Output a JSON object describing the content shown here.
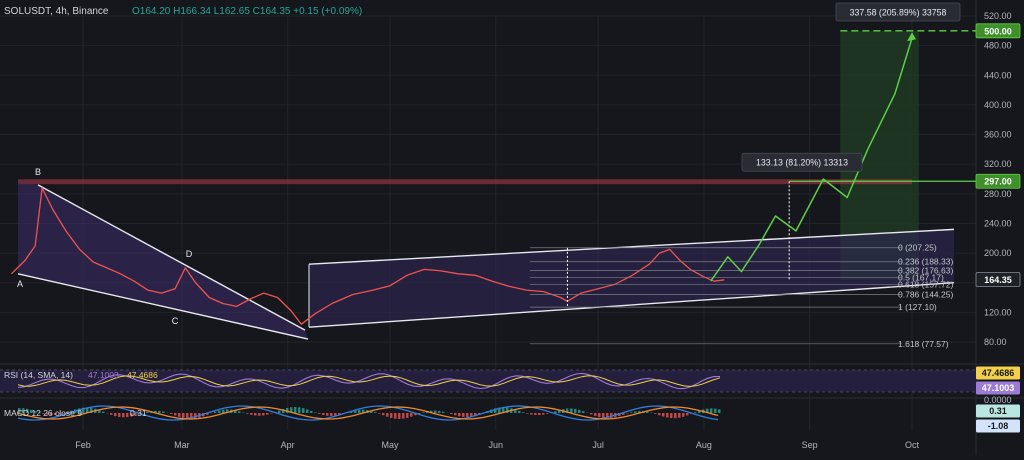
{
  "header": {
    "symbol": "SOLUSDT, 4h, Binance",
    "ohlc": "O164.20  H166.34  L162.65  C164.35  +0.15 (+0.09%)"
  },
  "colors": {
    "background": "#16171c",
    "grid": "#22242b",
    "wedge_fill": "#3d2e6b",
    "channel_fill": "#2f2654",
    "target_zone": "#1f3a24",
    "projection": "#5fcf45",
    "resistance": "#b23a48",
    "candle_up": "#26a69a",
    "candle_down": "#ef5350",
    "rsi": "#9c7bd6",
    "rsi_ma": "#f2d04a",
    "macd": "#2f7fe0",
    "signal": "#f08a2e",
    "axis_text": "#b2b5be"
  },
  "chart_data": [
    {
      "type": "line",
      "title": "SOLUSDT, 4h, Binance",
      "x_ticks": [
        "Feb",
        "Mar",
        "Apr",
        "May",
        "Jun",
        "Jul",
        "Aug",
        "Sep",
        "Oct"
      ],
      "y_ticks": [
        80,
        120,
        160,
        200,
        240,
        280,
        320,
        360,
        400,
        440,
        480,
        520
      ],
      "y_tick_labels": [
        "80.00",
        "120.00",
        "160.00",
        "200.00",
        "240.00",
        "280.00",
        "320.00",
        "360.00",
        "400.00",
        "440.00",
        "480.00",
        "520.00"
      ],
      "ylim": [
        60,
        540
      ],
      "series": [
        {
          "values": [
            [
              "Jan 11",
              172
            ],
            [
              "Jan 15",
              190
            ],
            [
              "Jan 18",
              210
            ],
            [
              "Jan 20",
              288
            ],
            [
              "Jan 23",
              260
            ],
            [
              "Jan 27",
              230
            ],
            [
              "Jan 31",
              205
            ],
            [
              "Feb 4",
              188
            ],
            [
              "Feb 8",
              180
            ],
            [
              "Feb 12",
              172
            ],
            [
              "Feb 16",
              162
            ],
            [
              "Feb 20",
              150
            ],
            [
              "Feb 24",
              146
            ],
            [
              "Feb 28",
              152
            ],
            [
              "Mar 2",
              180
            ],
            [
              "Mar 5",
              160
            ],
            [
              "Mar 9",
              140
            ],
            [
              "Mar 13",
              132
            ],
            [
              "Mar 17",
              128
            ],
            [
              "Mar 21",
              138
            ],
            [
              "Mar 25",
              146
            ],
            [
              "Mar 29",
              140
            ],
            [
              "Apr 2",
              122
            ],
            [
              "Apr 5",
              104
            ],
            [
              "Apr 9",
              118
            ],
            [
              "Apr 14",
              132
            ],
            [
              "Apr 20",
              144
            ],
            [
              "Apr 26",
              150
            ],
            [
              "May 1",
              156
            ],
            [
              "May 6",
              170
            ],
            [
              "May 11",
              178
            ],
            [
              "May 16",
              176
            ],
            [
              "May 21",
              172
            ],
            [
              "May 26",
              170
            ],
            [
              "May 31",
              162
            ],
            [
              "Jun 5",
              155
            ],
            [
              "Jun 10",
              150
            ],
            [
              "Jun 15",
              148
            ],
            [
              "Jun 20",
              140
            ],
            [
              "Jun 22",
              135
            ],
            [
              "Jun 26",
              146
            ],
            [
              "Jul 1",
              152
            ],
            [
              "Jul 6",
              158
            ],
            [
              "Jul 11",
              170
            ],
            [
              "Jul 16",
              185
            ],
            [
              "Jul 19",
              200
            ],
            [
              "Jul 22",
              205
            ],
            [
              "Jul 25",
              190
            ],
            [
              "Jul 28",
              178
            ],
            [
              "Aug 1",
              168
            ],
            [
              "Aug 4",
              162
            ],
            [
              "Aug 7",
              164
            ]
          ]
        }
      ],
      "price_tags": [
        "500.00",
        "297.00",
        "164.35"
      ],
      "patterns": {
        "wedge_labels": [
          "A",
          "B",
          "C",
          "D"
        ],
        "channel": "ascending channel"
      },
      "fibonacci": [
        {
          "label": "0 (207.25)",
          "value": 207.25
        },
        {
          "label": "0.236 (188.33)",
          "value": 188.33
        },
        {
          "label": "0.382 (176.63)",
          "value": 176.63
        },
        {
          "label": "0.5 (167.17)",
          "value": 167.17
        },
        {
          "label": "0.618 (157.72)",
          "value": 157.72
        },
        {
          "label": "0.786 (144.25)",
          "value": 144.25
        },
        {
          "label": "1 (127.10)",
          "value": 127.1
        },
        {
          "label": "1.618 (77.57)",
          "value": 77.57
        }
      ],
      "levels": [
        297.0,
        500.0
      ],
      "measurements": [
        {
          "text": "133.13 (81.20%) 13313",
          "from": 164,
          "to": 297
        },
        {
          "text": "337.58 (205.89%) 33758",
          "from": 164,
          "to": 500
        }
      ],
      "projection_path": [
        [
          "Aug 3",
          162
        ],
        [
          "Aug 8",
          195
        ],
        [
          "Aug 12",
          175
        ],
        [
          "Aug 17",
          210
        ],
        [
          "Aug 22",
          250
        ],
        [
          "Aug 28",
          230
        ],
        [
          "Sep 5",
          300
        ],
        [
          "Sep 12",
          275
        ],
        [
          "Sep 18",
          340
        ],
        [
          "Sep 26",
          415
        ],
        [
          "Oct 1",
          490
        ]
      ]
    },
    {
      "type": "line",
      "title": "RSI",
      "legend": "RSI (14, SMA, 14)",
      "values_shown": [
        "47.1003",
        "47.4686"
      ],
      "price_tags": [
        "47.4686",
        "47.1003"
      ],
      "y_ticks": [
        "0.0000"
      ]
    },
    {
      "type": "bar",
      "title": "MACD",
      "legend": "MACD 12 26 close 9",
      "values_shown": [
        "0.31"
      ],
      "price_tags": [
        "0.31",
        "-1.08"
      ]
    }
  ]
}
